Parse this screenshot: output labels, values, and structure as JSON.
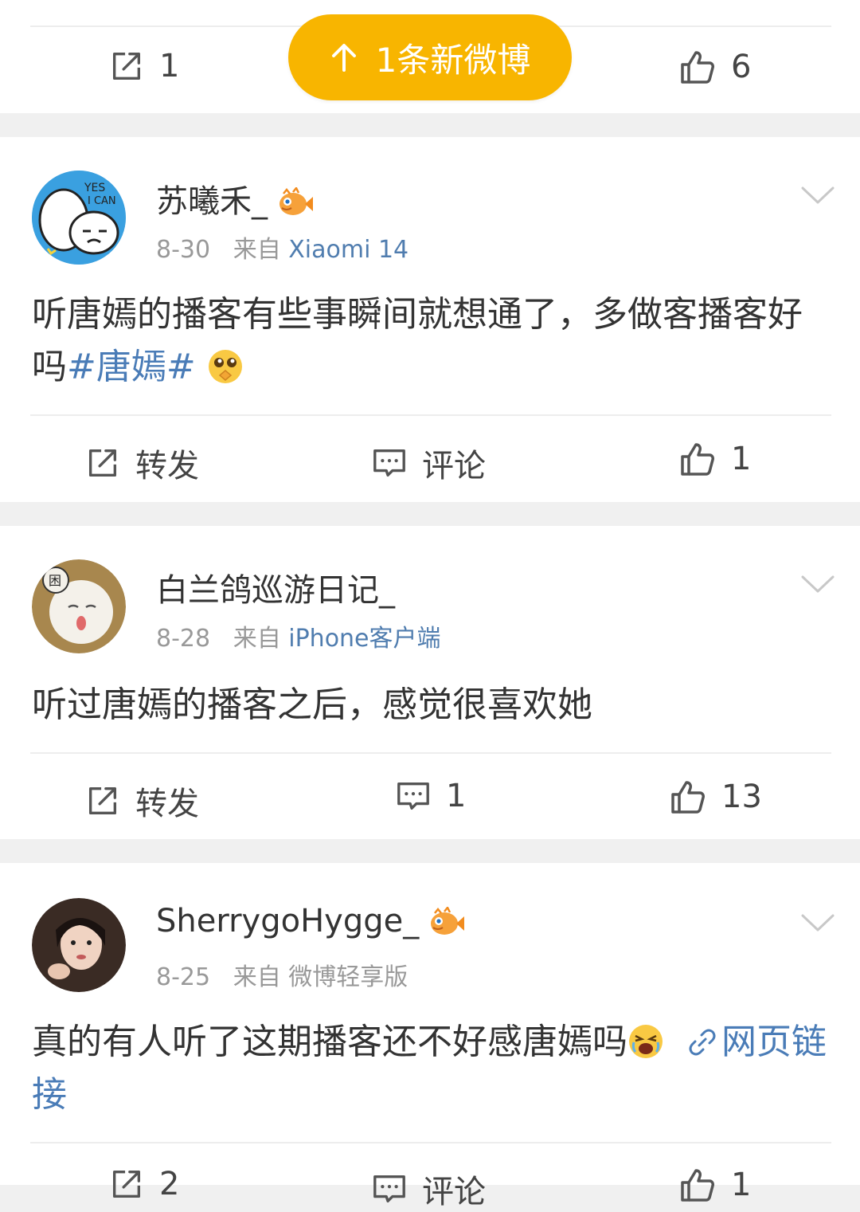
{
  "new_posts_pill": {
    "label": "1条新微博"
  },
  "top_bar": {
    "repost_count": "1",
    "like_count": "6"
  },
  "posts": [
    {
      "username": "苏曦禾_",
      "date": "8-30",
      "from_label": "来自",
      "source": "Xiaomi 14",
      "text": "听唐嫣的播客有些事瞬间就想通了，多做客播客好吗",
      "topic": "#唐嫣#",
      "actions": {
        "repost": "转发",
        "comment": "评论",
        "like": "1"
      }
    },
    {
      "username": "白兰鸽巡游日记_",
      "date": "8-28",
      "from_label": "来自",
      "source": "iPhone客户端",
      "text": "听过唐嫣的播客之后，感觉很喜欢她",
      "actions": {
        "repost": "转发",
        "comment": "1",
        "like": "13"
      }
    },
    {
      "username": "SherrygoHygge_",
      "date": "8-25",
      "from_label": "来自",
      "source": "微博轻享版",
      "text": "真的有人听了这期播客还不好感唐嫣吗",
      "link": "网页链接",
      "actions": {
        "repost": "2",
        "comment": "评论",
        "like": "1"
      }
    }
  ],
  "colors": {
    "accent": "#f8b500",
    "link": "#4a7cb7",
    "source": "#507daf",
    "meta": "#999999",
    "background": "#f0f0f0"
  },
  "icons": [
    "repost-icon",
    "comment-icon",
    "like-icon",
    "chevron-down-icon",
    "up-arrow-icon",
    "link-icon",
    "pufferfish-badge-icon"
  ]
}
